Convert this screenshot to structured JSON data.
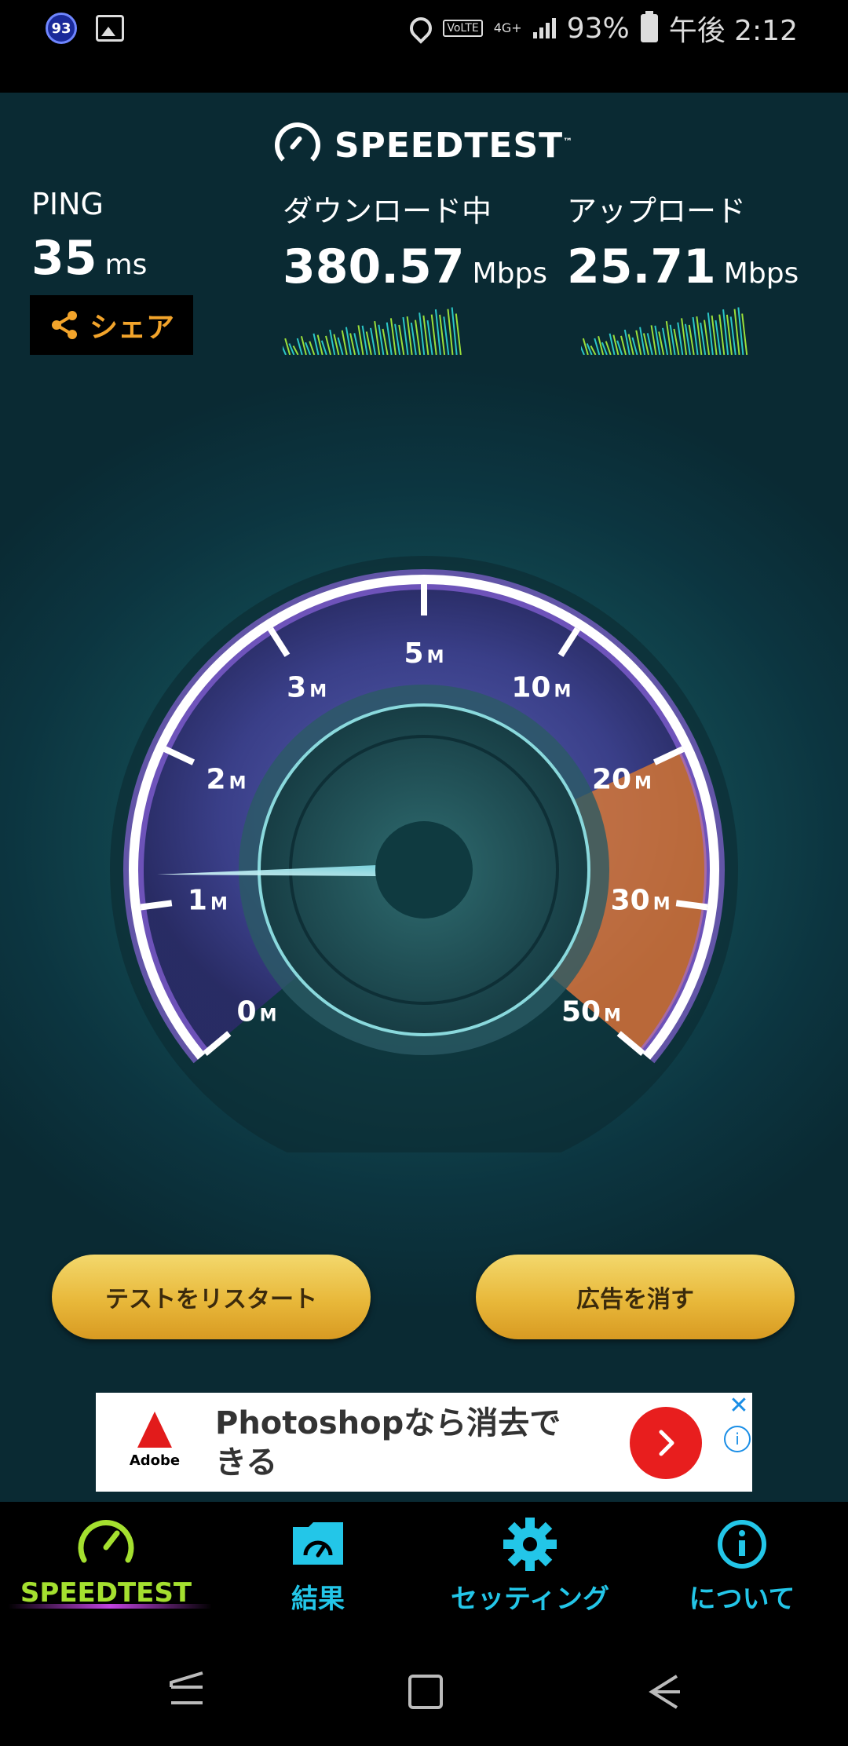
{
  "status_bar": {
    "notification_count": "93",
    "network": "4G+",
    "battery": "93%",
    "time": "午後 2:12",
    "volte": "VoLTE"
  },
  "header": {
    "logo_text": "SPEEDTEST",
    "trademark": "™"
  },
  "ping": {
    "label": "PING",
    "value": "35",
    "unit": "ms"
  },
  "download": {
    "label": "ダウンロード中",
    "value": "380.57",
    "unit": "Mbps"
  },
  "upload": {
    "label": "アップロード",
    "value": "25.71",
    "unit": "Mbps"
  },
  "share": {
    "label": "シェア"
  },
  "gauge": {
    "ticks": [
      "0",
      "1",
      "2",
      "3",
      "5",
      "10",
      "20",
      "30",
      "50"
    ],
    "tick_suffix": "M",
    "needle_value": 0.15,
    "colors": {
      "ring": "#ffffff",
      "glow_purple": "#9b6cf0",
      "fill_orange": "#e97d2b",
      "needle": "#9ff3ff"
    }
  },
  "buttons": {
    "restart": "テストをリスタート",
    "remove_ads": "広告を消す"
  },
  "ad": {
    "brand": "Adobe",
    "text": "Photoshopなら消去できる",
    "close": "✕",
    "info": "i"
  },
  "nav": [
    {
      "label": "SPEEDTEST",
      "icon": "speedometer-icon",
      "active": true
    },
    {
      "label": "結果",
      "icon": "results-folder-icon",
      "active": false
    },
    {
      "label": "セッティング",
      "icon": "gear-icon",
      "active": false
    },
    {
      "label": "について",
      "icon": "info-icon",
      "active": false
    }
  ],
  "colors": {
    "accent_green": "#a4e02f",
    "accent_cyan": "#23c6e8",
    "share_orange": "#f2a42b",
    "button_gold": "#e8b83a"
  }
}
